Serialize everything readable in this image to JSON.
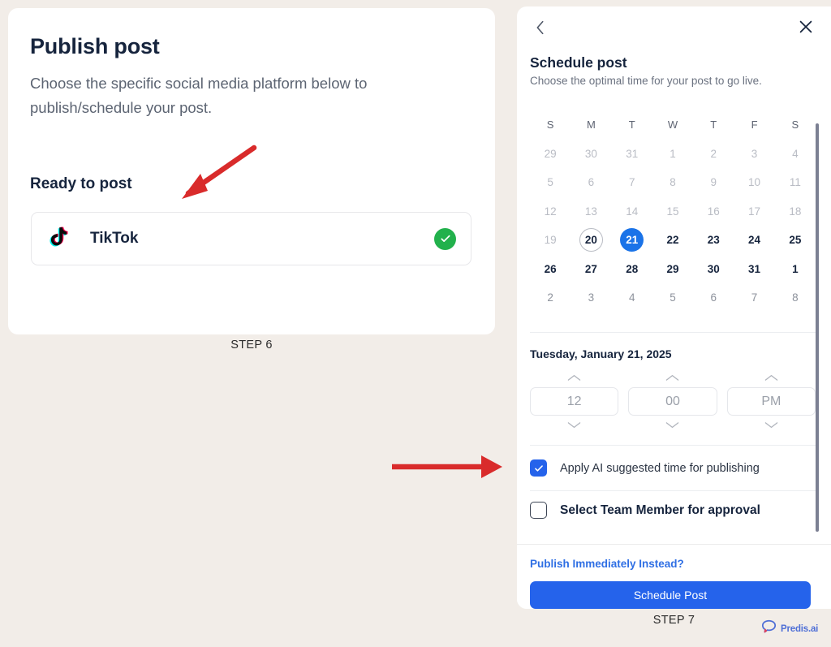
{
  "left_card": {
    "title": "Publish post",
    "subtitle": "Choose the specific social media platform below to publish/schedule your post.",
    "section_label": "Ready to post",
    "platform": {
      "name": "TikTok",
      "icon": "tiktok-icon",
      "status_icon": "check-circle-icon",
      "status_color": "#22b14c"
    },
    "step_label": "STEP 6"
  },
  "right_panel": {
    "back_icon": "chevron-left-icon",
    "close_icon": "close-icon",
    "title": "Schedule post",
    "subtitle": "Choose the optimal time for your post to go live.",
    "calendar": {
      "weekday_headers": [
        "S",
        "M",
        "T",
        "W",
        "T",
        "F",
        "S"
      ],
      "weeks": [
        [
          {
            "day": "29",
            "state": "muted"
          },
          {
            "day": "30",
            "state": "muted"
          },
          {
            "day": "31",
            "state": "muted"
          },
          {
            "day": "1",
            "state": "muted"
          },
          {
            "day": "2",
            "state": "muted"
          },
          {
            "day": "3",
            "state": "muted"
          },
          {
            "day": "4",
            "state": "muted"
          }
        ],
        [
          {
            "day": "5",
            "state": "muted"
          },
          {
            "day": "6",
            "state": "muted"
          },
          {
            "day": "7",
            "state": "muted"
          },
          {
            "day": "8",
            "state": "muted"
          },
          {
            "day": "9",
            "state": "muted"
          },
          {
            "day": "10",
            "state": "muted"
          },
          {
            "day": "11",
            "state": "muted"
          }
        ],
        [
          {
            "day": "12",
            "state": "muted"
          },
          {
            "day": "13",
            "state": "muted"
          },
          {
            "day": "14",
            "state": "muted"
          },
          {
            "day": "15",
            "state": "muted"
          },
          {
            "day": "16",
            "state": "muted"
          },
          {
            "day": "17",
            "state": "muted"
          },
          {
            "day": "18",
            "state": "muted"
          }
        ],
        [
          {
            "day": "19",
            "state": "muted"
          },
          {
            "day": "20",
            "state": "today"
          },
          {
            "day": "21",
            "state": "selected"
          },
          {
            "day": "22",
            "state": "normal"
          },
          {
            "day": "23",
            "state": "normal"
          },
          {
            "day": "24",
            "state": "normal"
          },
          {
            "day": "25",
            "state": "normal"
          }
        ],
        [
          {
            "day": "26",
            "state": "normal"
          },
          {
            "day": "27",
            "state": "normal"
          },
          {
            "day": "28",
            "state": "normal"
          },
          {
            "day": "29",
            "state": "normal"
          },
          {
            "day": "30",
            "state": "normal"
          },
          {
            "day": "31",
            "state": "normal"
          },
          {
            "day": "1",
            "state": "normal"
          }
        ],
        [
          {
            "day": "2",
            "state": "next"
          },
          {
            "day": "3",
            "state": "next"
          },
          {
            "day": "4",
            "state": "next"
          },
          {
            "day": "5",
            "state": "next"
          },
          {
            "day": "6",
            "state": "next"
          },
          {
            "day": "7",
            "state": "next"
          },
          {
            "day": "8",
            "state": "next"
          }
        ]
      ],
      "selected_day": "21",
      "today_day": "20",
      "selected_color": "#1a73e8"
    },
    "selected_date_text": "Tuesday, January 21, 2025",
    "time_picker": {
      "hour": "12",
      "minute": "00",
      "meridiem": "PM",
      "up_icon": "chevron-up-icon",
      "down_icon": "chevron-down-icon"
    },
    "options": [
      {
        "label": "Apply AI suggested time for publishing",
        "checked": true,
        "icon": "checkbox-checked-icon"
      },
      {
        "label": "Select Team Member for approval",
        "checked": false,
        "icon": "checkbox-unchecked-icon"
      }
    ],
    "footer": {
      "link_label": "Publish Immediately Instead?",
      "primary_button_label": "Schedule Post",
      "primary_button_color": "#2563eb",
      "link_color": "#2f6fe4"
    },
    "step_label": "STEP 7"
  },
  "brand": {
    "name": "Predis.ai",
    "icon": "predis-speech-bubble-icon",
    "color": "#4f6fd6"
  },
  "annotations": {
    "arrow_color": "#d92b2b",
    "arrow_top_target": "Ready to post / TikTok row",
    "arrow_bottom_target": "Apply AI suggested time checkbox"
  }
}
